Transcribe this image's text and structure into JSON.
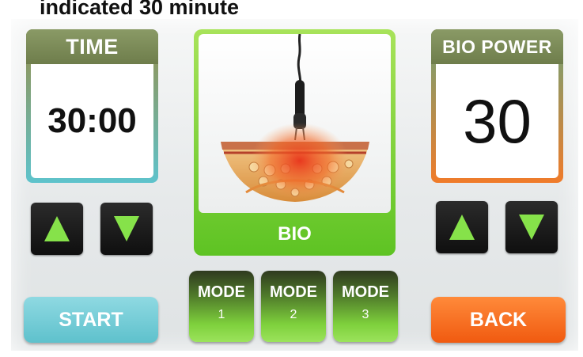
{
  "caption": "indicated 30 minute",
  "time": {
    "label": "TIME",
    "value": "30:00"
  },
  "power": {
    "label": "BIO POWER",
    "value": "30"
  },
  "mode_panel": {
    "label": "BIO"
  },
  "modes": [
    {
      "label": "MODE",
      "number": "1"
    },
    {
      "label": "MODE",
      "number": "2"
    },
    {
      "label": "MODE",
      "number": "3"
    }
  ],
  "buttons": {
    "start": "START",
    "back": "BACK"
  },
  "icons": {
    "up": "up-arrow-icon",
    "down": "down-arrow-icon"
  },
  "colors": {
    "accent_green": "#86e24a",
    "start": "#5ec1cc",
    "back": "#f05a10",
    "header": "#7b8a5a"
  }
}
